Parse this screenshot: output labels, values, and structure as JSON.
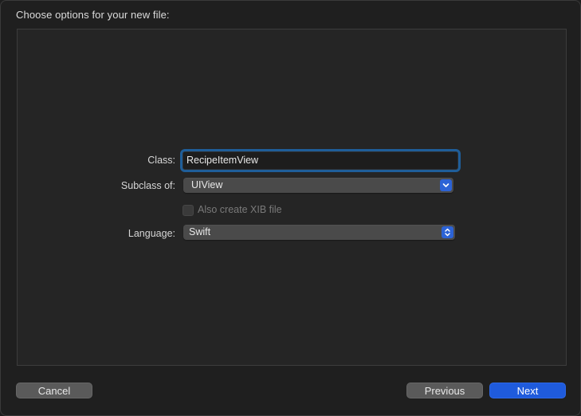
{
  "dialog": {
    "heading": "Choose options for your new file:"
  },
  "form": {
    "class_label": "Class:",
    "class_value": "RecipeItemView",
    "subclass_label": "Subclass of:",
    "subclass_value": "UIView",
    "xib_label": "Also create XIB file",
    "xib_checked": false,
    "xib_enabled": false,
    "language_label": "Language:",
    "language_value": "Swift"
  },
  "buttons": {
    "cancel": "Cancel",
    "previous": "Previous",
    "next": "Next"
  },
  "colors": {
    "accent": "#1f5bdc",
    "focus_ring": "#1f5e99"
  }
}
